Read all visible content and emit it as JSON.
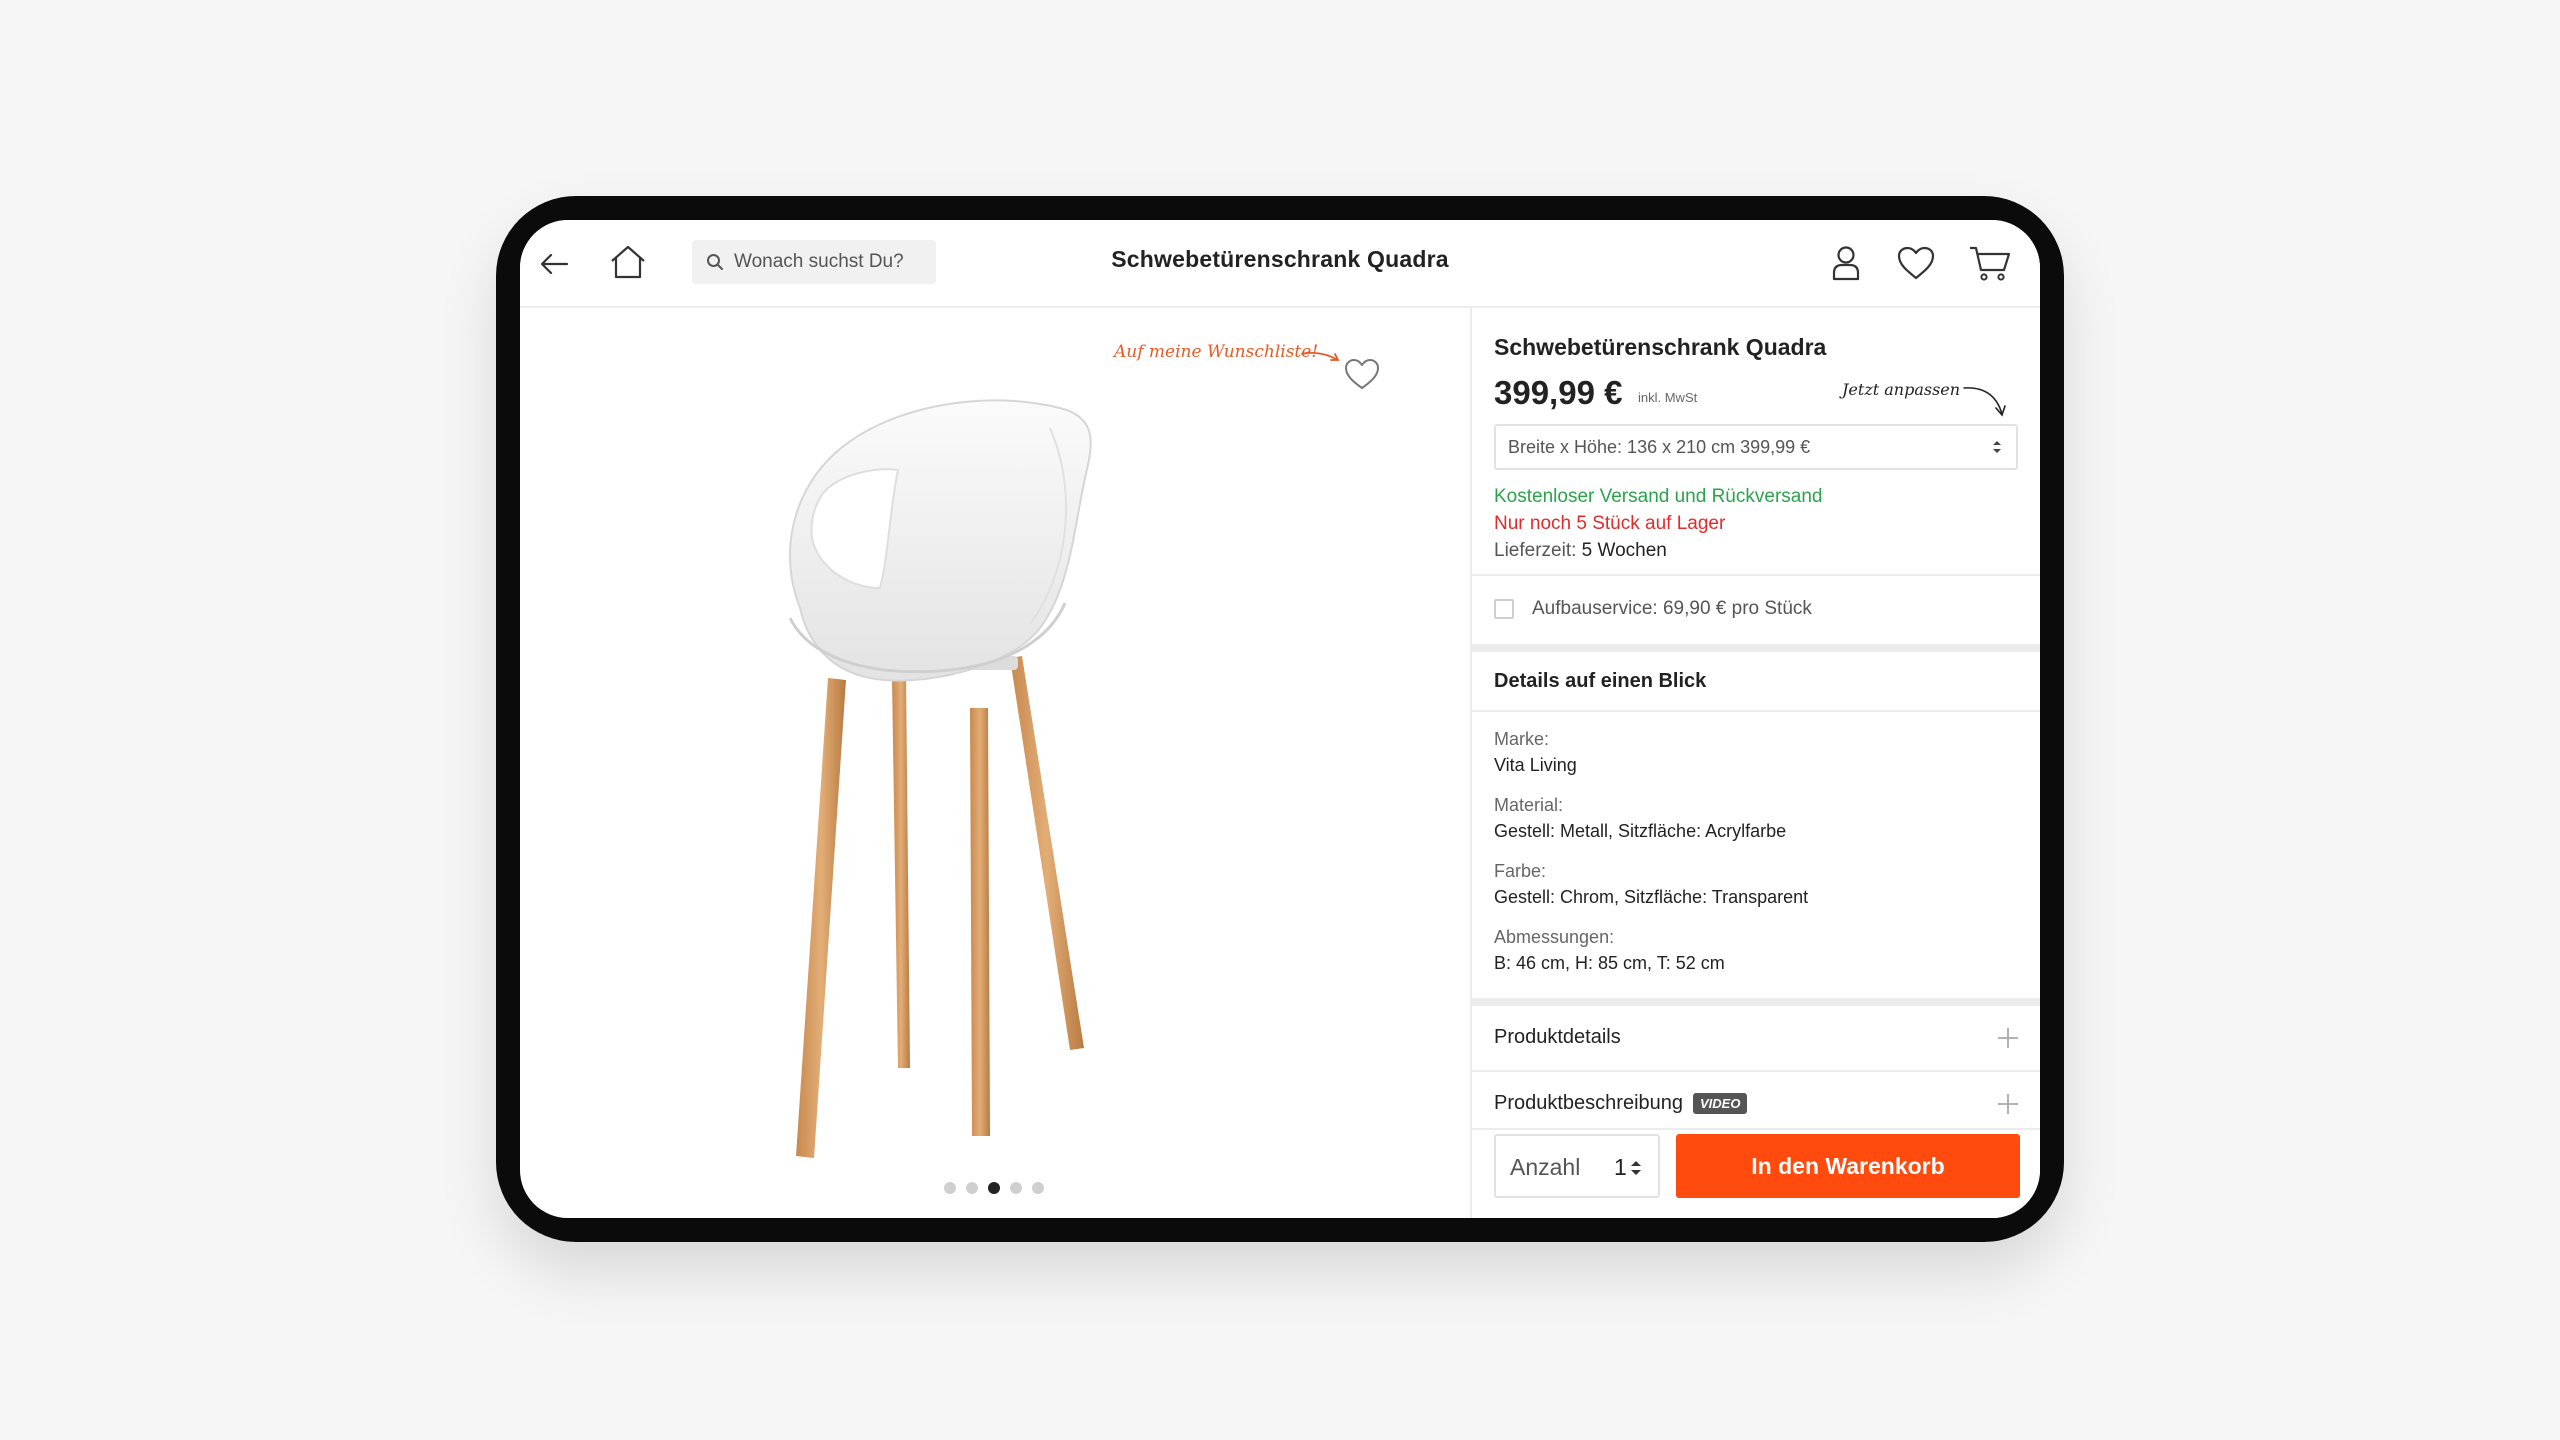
{
  "header": {
    "search_placeholder": "Wonach suchst Du?",
    "title": "Schwebetürenschrank Quadra",
    "icons": [
      "back-arrow-icon",
      "home-icon",
      "search-icon",
      "user-icon",
      "heart-icon",
      "cart-icon"
    ]
  },
  "gallery": {
    "wishlist_note": "Auf meine Wunschliste!",
    "dot_count": 5,
    "active_dot": 3
  },
  "product": {
    "title": "Schwebetürenschrank Quadra",
    "price": "399,99 €",
    "price_note": "inkl. MwSt",
    "adjust_note": "Jetzt anpassen",
    "variant": "Breite x Höhe: 136 x 210 cm 399,99 €",
    "shipping": "Kostenloser Versand und Rückversand",
    "stock": "Nur noch 5 Stück auf Lager",
    "delivery_label": "Lieferzeit:",
    "delivery_value": "5 Wochen",
    "service": "Aufbauservice: 69,90 € pro Stück"
  },
  "details": {
    "title": "Details auf einen Blick",
    "specs": [
      {
        "label": "Marke:",
        "value": "Vita Living"
      },
      {
        "label": "Material:",
        "value": "Gestell: Metall, Sitzfläche: Acrylfarbe"
      },
      {
        "label": "Farbe:",
        "value": "Gestell: Chrom, Sitzfläche: Transparent"
      },
      {
        "label": "Abmessungen:",
        "value": "B: 46 cm, H: 85 cm, T: 52 cm"
      }
    ]
  },
  "accordion": {
    "product_details": "Produktdetails",
    "product_description": "Produktbeschreibung",
    "video_badge": "VIDEO"
  },
  "purchase": {
    "quantity_label": "Anzahl",
    "quantity_value": "1",
    "cart_button": "In den Warenkorb"
  },
  "colors": {
    "accent": "#ff4c0e",
    "success": "#2aa44a",
    "warning": "#e32a2a"
  }
}
